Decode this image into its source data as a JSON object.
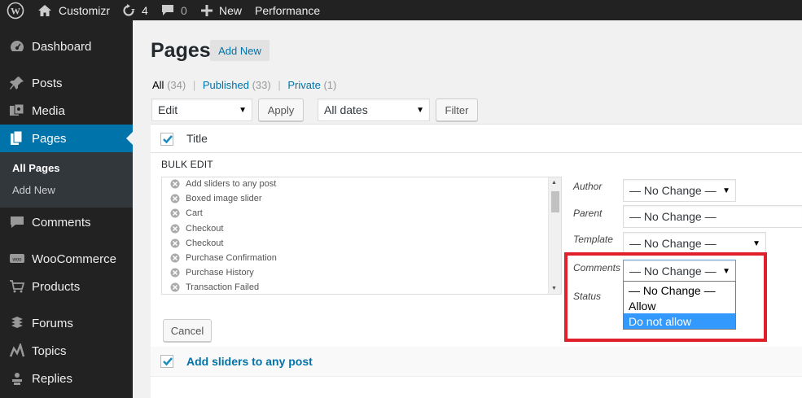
{
  "admin_bar": {
    "site_name": "Customizr",
    "updates_count": "4",
    "comments_count": "0",
    "new_label": "New",
    "performance_label": "Performance"
  },
  "sidebar": {
    "items": [
      {
        "label": "Dashboard",
        "icon": "dashboard-icon"
      },
      {
        "label": "Posts",
        "icon": "pushpin-icon"
      },
      {
        "label": "Media",
        "icon": "media-icon"
      },
      {
        "label": "Pages",
        "icon": "pages-icon"
      },
      {
        "label": "Comments",
        "icon": "comment-icon"
      },
      {
        "label": "WooCommerce",
        "icon": "woocommerce-icon"
      },
      {
        "label": "Products",
        "icon": "cart-icon"
      },
      {
        "label": "Forums",
        "icon": "forums-icon"
      },
      {
        "label": "Topics",
        "icon": "topics-icon"
      },
      {
        "label": "Replies",
        "icon": "replies-icon"
      }
    ],
    "submenu": [
      "All Pages",
      "Add New"
    ]
  },
  "main": {
    "title": "Pages",
    "add_new": "Add New",
    "filters": {
      "all": "All",
      "all_count": "(34)",
      "published": "Published",
      "published_count": "(33)",
      "private": "Private",
      "private_count": "(1)",
      "separator": "|"
    },
    "bulk_action": "Edit",
    "apply": "Apply",
    "dates": "All dates",
    "filter": "Filter",
    "title_column": "Title",
    "bulk_edit": {
      "legend": "BULK EDIT",
      "items": [
        "Add sliders to any post",
        "Boxed image slider",
        "Cart",
        "Checkout",
        "Checkout",
        "Purchase Confirmation",
        "Purchase History",
        "Transaction Failed"
      ],
      "author_label": "Author",
      "author_value": "— No Change —",
      "parent_label": "Parent",
      "parent_value": "— No Change —",
      "template_label": "Template",
      "template_value": "— No Change —",
      "comments_label": "Comments",
      "comments_value": "— No Change —",
      "status_label": "Status",
      "cancel": "Cancel"
    },
    "comments_options": [
      "— No Change —",
      "Allow",
      "Do not allow"
    ],
    "comments_highlighted": "Do not allow",
    "row_title": "Add sliders to any post"
  },
  "colors": {
    "accent": "#0073aa",
    "highlight": "#e0202a",
    "selected_option": "#3399ff"
  }
}
